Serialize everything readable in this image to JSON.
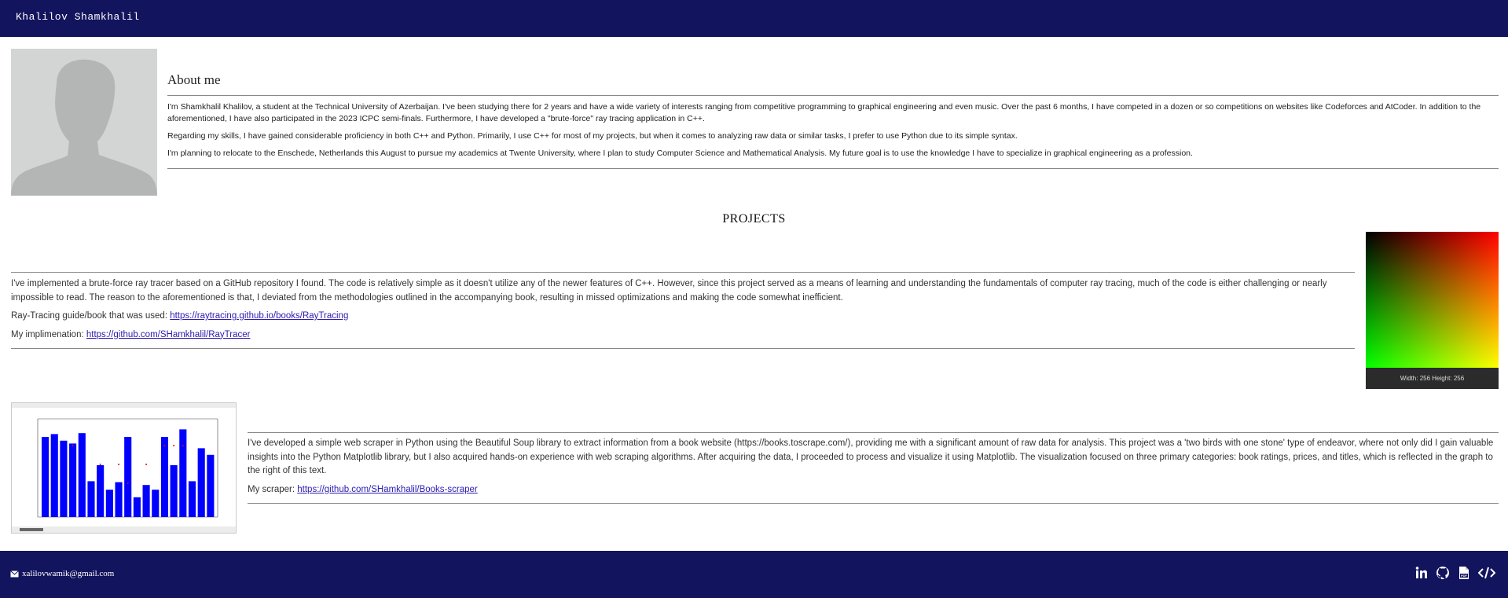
{
  "header": {
    "name": "Khalilov Shamkhalil"
  },
  "about": {
    "title": "About me",
    "paragraphs": [
      "I'm Shamkhalil Khalilov, a student at the Technical University of Azerbaijan. I've been studying there for 2 years and have a wide variety of interests ranging from competitive programming to graphical engineering and even music. Over the past 6 months, I have competed in a dozen or so competitions on websites like Codeforces and AtCoder. In addition to the aforementioned, I have also participated in the 2023 ICPC semi-finals. Furthermore, I have developed a \"brute-force\" ray tracing application in C++.",
      "Regarding my skills, I have gained considerable proficiency in both C++ and Python. Primarily, I use C++ for most of my projects, but when it comes to analyzing raw data or similar tasks, I prefer to use Python due to its simple syntax.",
      "I'm planning to relocate to the Enschede, Netherlands this August to pursue my academics at Twente University, where I plan to study Computer Science and Mathematical Analysis. My future goal is to use the knowledge I have to specialize in graphical engineering as a profession."
    ]
  },
  "projects": {
    "title": "PROJECTS",
    "raytracer": {
      "description": "I've implemented a brute-force ray tracer based on a GitHub repository I found. The code is relatively simple as it doesn't utilize any of the newer features of C++. However, since this project served as a means of learning and understanding the fundamentals of computer ray tracing, much of the code is either challenging or nearly impossible to read. The reason to the aforementioned is that, I deviated from the methodologies outlined in the accompanying book, resulting in missed optimizations and making the code somewhat inefficient.",
      "guide_label": "Ray-Tracing guide/book that was used: ",
      "guide_link": "https://raytracing.github.io/books/RayTracing",
      "impl_label": "My implimenation: ",
      "impl_link": "https://github.com/SHamkhalil/RayTracer",
      "image_caption": "Width: 256 Height: 256"
    },
    "scraper": {
      "description": "I've developed a simple web scraper in Python using the Beautiful Soup library to extract information from a book website (https://books.toscrape.com/), providing me with a significant amount of raw data for analysis. This project was a 'two birds with one stone' type of endeavor, where not only did I gain valuable insights into the Python Matplotlib library, but I also acquired hands-on experience with web scraping algorithms. After acquiring the data, I proceeded to process and visualize it using Matplotlib. The visualization focused on three primary categories: book ratings, prices, and titles, which is reflected in the graph to the right of this text.",
      "link_label": "My scraper: ",
      "link": "https://github.com/SHamkhalil/Books-scraper",
      "screenshot_bars": [
        85,
        88,
        81,
        78,
        89,
        38,
        55,
        29,
        37,
        85,
        21,
        34,
        29,
        85,
        55,
        93,
        38,
        73,
        66
      ],
      "screenshot_dots": [
        null,
        null,
        null,
        4,
        null,
        null,
        3,
        null,
        3,
        2,
        null,
        3,
        null,
        4,
        4,
        4,
        null,
        null,
        null
      ]
    }
  },
  "footer": {
    "email": "xalilovwamik@gmail.com",
    "icons": [
      "linkedin-icon",
      "github-icon",
      "pdf-icon",
      "code-icon"
    ]
  }
}
